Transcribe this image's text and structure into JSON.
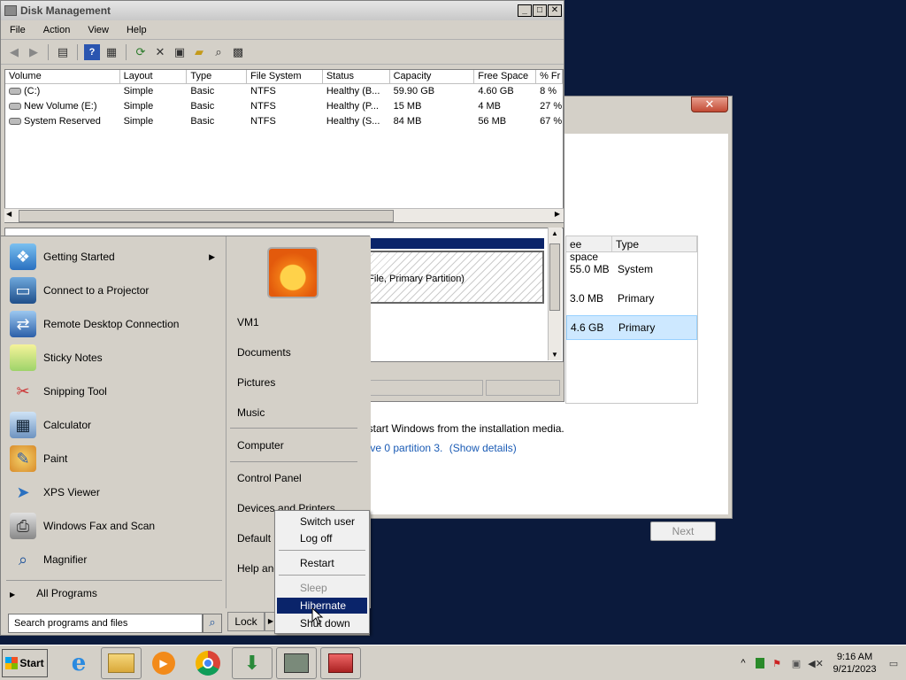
{
  "setup_dialog": {
    "close_label": "✕",
    "table_headers": [
      "ee space",
      "Type"
    ],
    "rows": [
      {
        "free": "55.0 MB",
        "type": "System"
      },
      {
        "free": "3.0 MB",
        "type": "Primary"
      },
      {
        "free": "4.6 GB",
        "type": "Primary"
      }
    ],
    "message1": "restart Windows from the installation media.",
    "message2": "drive 0 partition 3.",
    "show_details": "(Show details)",
    "next_label": "Next"
  },
  "disk_management": {
    "title": "Disk Management",
    "menu": [
      "File",
      "Action",
      "View",
      "Help"
    ],
    "columns": [
      "Volume",
      "Layout",
      "Type",
      "File System",
      "Status",
      "Capacity",
      "Free Space",
      "% Fr"
    ],
    "rows": [
      [
        "(C:)",
        "Simple",
        "Basic",
        "NTFS",
        "Healthy (B...",
        "59.90 GB",
        "4.60 GB",
        "8 %"
      ],
      [
        "New Volume (E:)",
        "Simple",
        "Basic",
        "NTFS",
        "Healthy (P...",
        "15 MB",
        "4 MB",
        "27 %"
      ],
      [
        "System Reserved",
        "Simple",
        "Basic",
        "NTFS",
        "Healthy (S...",
        "84 MB",
        "56 MB",
        "67 %"
      ]
    ],
    "partition_text": "e File, Primary Partition)"
  },
  "start_menu": {
    "programs": [
      {
        "label": "Getting Started",
        "icon": "getting-started-icon",
        "has_arrow": true
      },
      {
        "label": "Connect to a Projector",
        "icon": "projector-icon"
      },
      {
        "label": "Remote Desktop Connection",
        "icon": "remote-desktop-icon"
      },
      {
        "label": "Sticky Notes",
        "icon": "sticky-notes-icon"
      },
      {
        "label": "Snipping Tool",
        "icon": "snipping-tool-icon"
      },
      {
        "label": "Calculator",
        "icon": "calculator-icon"
      },
      {
        "label": "Paint",
        "icon": "paint-icon"
      },
      {
        "label": "XPS Viewer",
        "icon": "xps-viewer-icon"
      },
      {
        "label": "Windows Fax and Scan",
        "icon": "fax-scan-icon"
      },
      {
        "label": "Magnifier",
        "icon": "magnifier-icon"
      }
    ],
    "all_programs": "All Programs",
    "search_placeholder": "Search programs and files",
    "right_items": {
      "vm1": "VM1",
      "documents": "Documents",
      "pictures": "Pictures",
      "music": "Music",
      "computer": "Computer",
      "control_panel": "Control Panel",
      "devices": "Devices and Printers",
      "default": "Default P",
      "help": "Help and"
    },
    "lock_label": "Lock",
    "arrow_label": "▶"
  },
  "power_menu": {
    "switch_user": "Switch user",
    "log_off": "Log off",
    "restart": "Restart",
    "sleep": "Sleep",
    "hibernate": "Hibernate",
    "shutdown": "Shut down"
  },
  "taskbar": {
    "start_label": "Start",
    "time": "9:16 AM",
    "date": "9/21/2023",
    "tray_chevron": "^"
  },
  "colors": {
    "desktop": "#0b1a3c",
    "selection": "#0a246a",
    "setup_selected_row": "#cde8ff"
  }
}
